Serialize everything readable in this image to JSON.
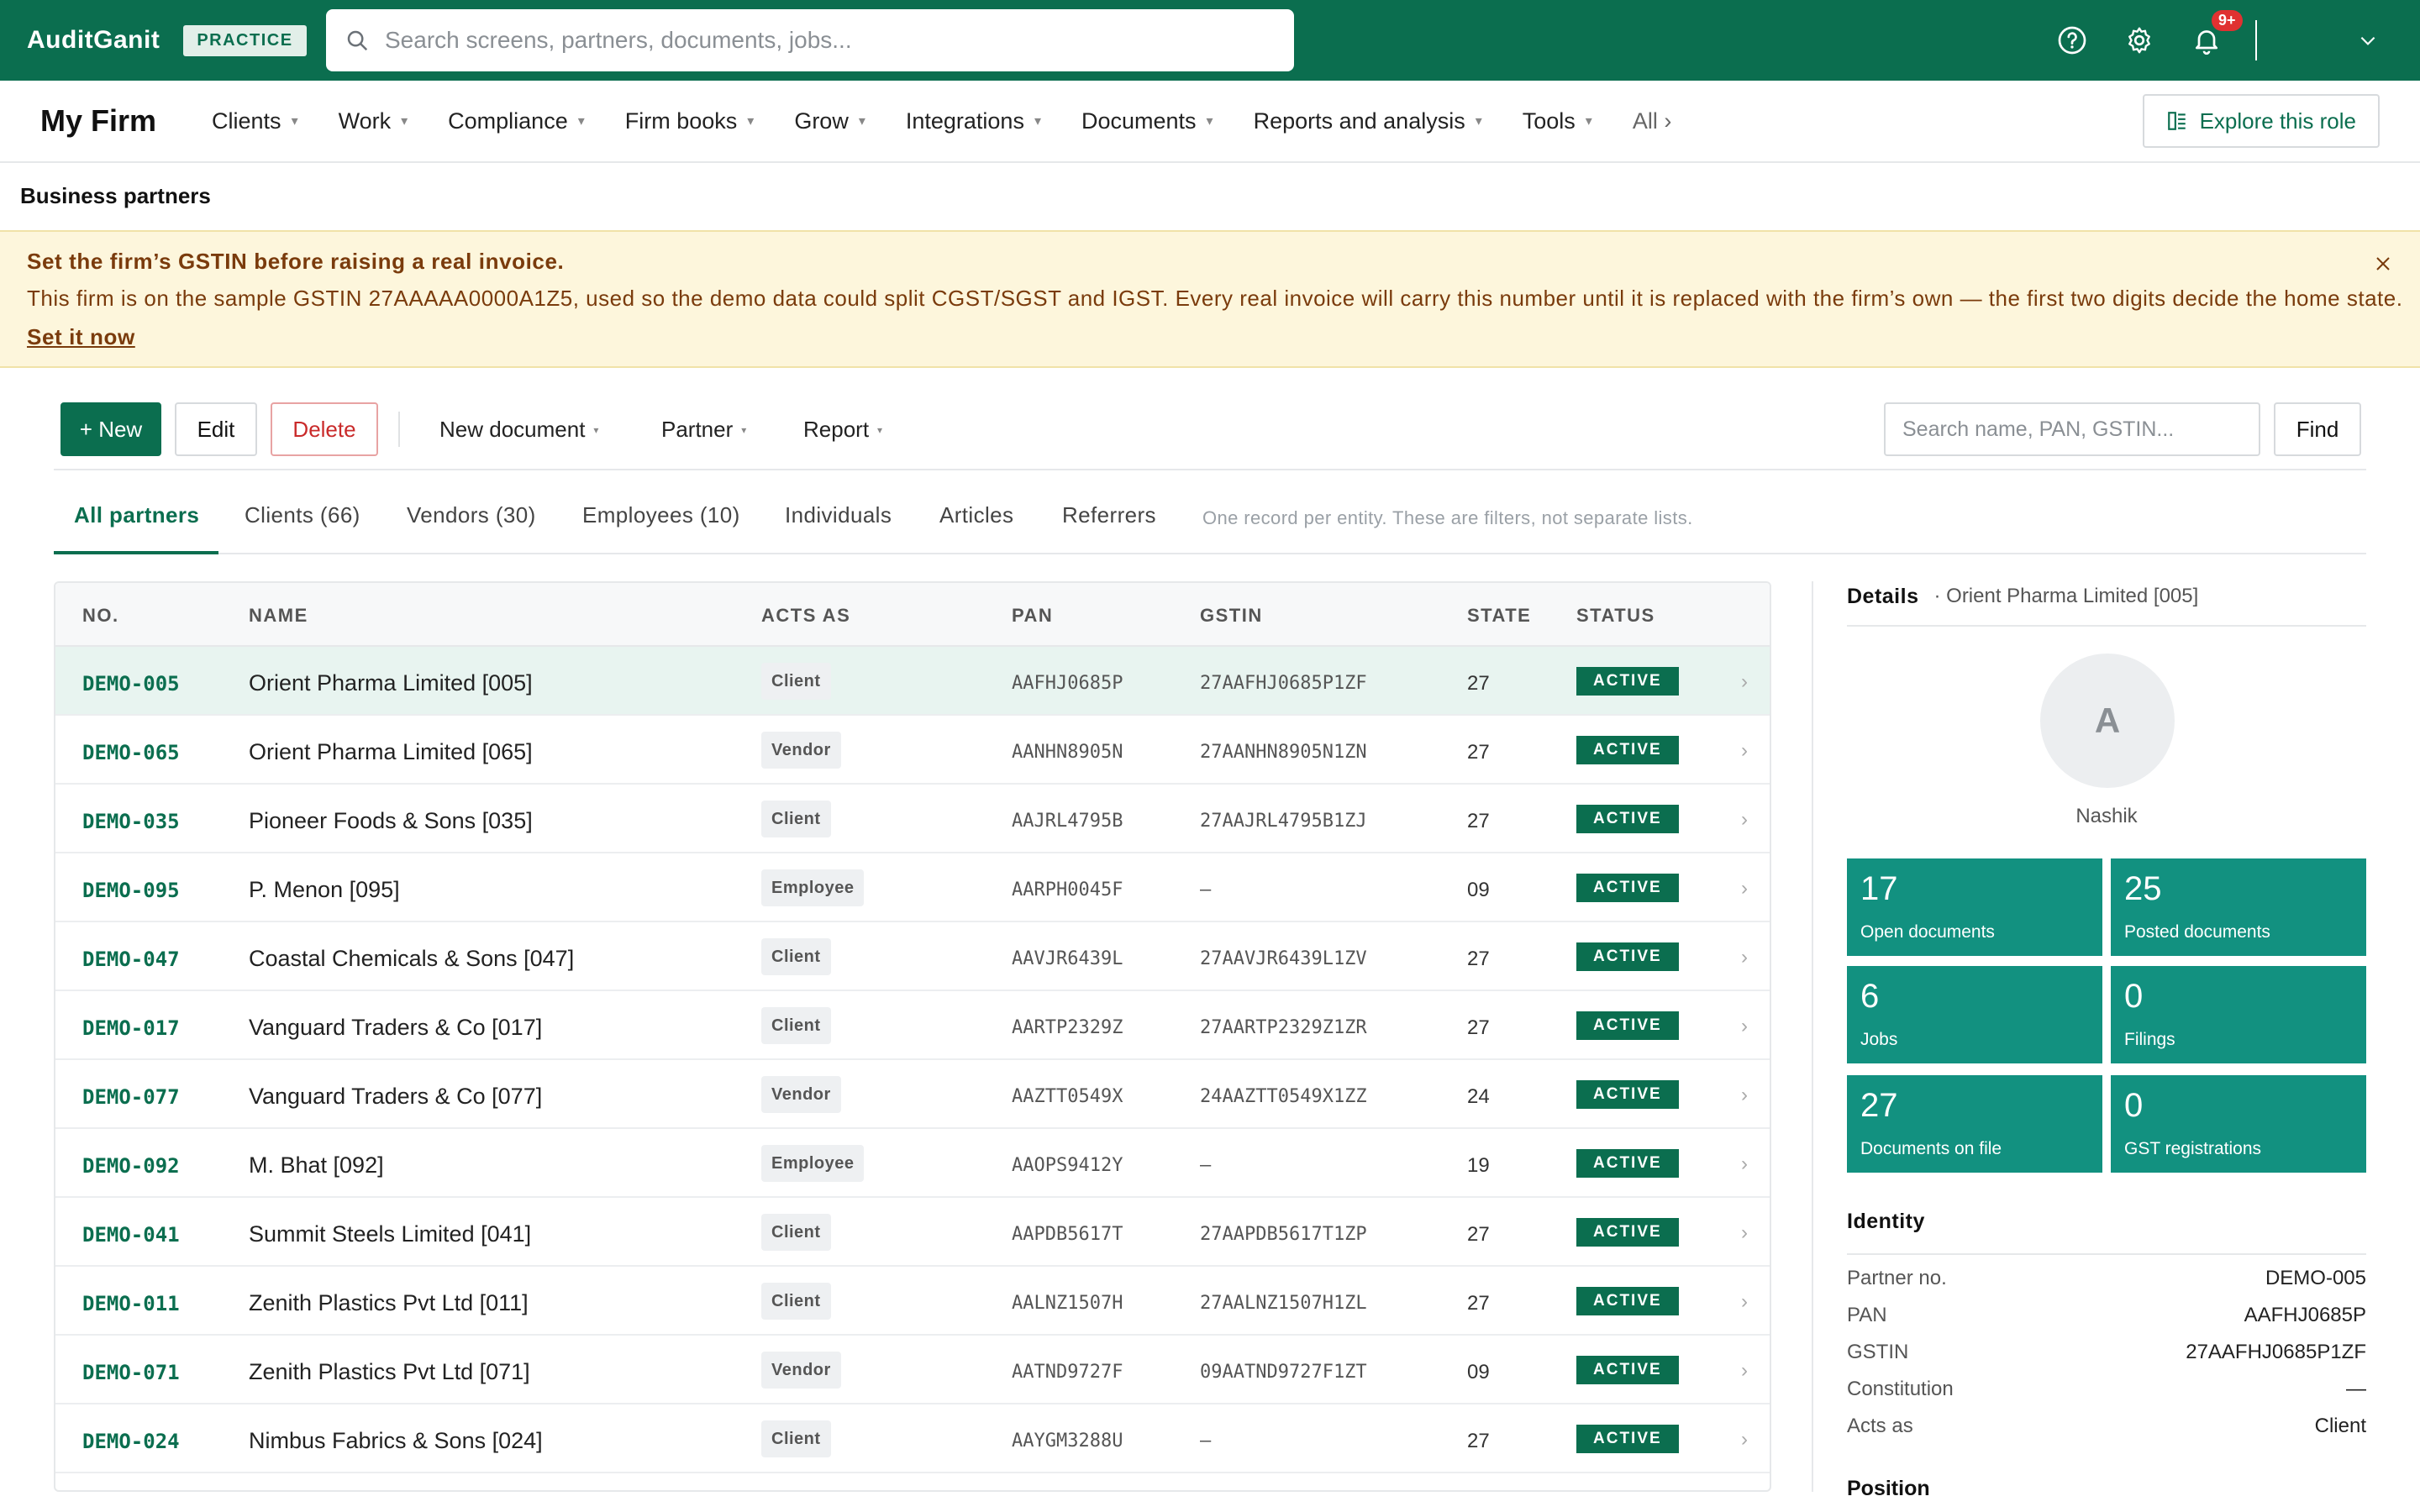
{
  "topbar": {
    "brand": "AuditGanit",
    "badge": "PRACTICE",
    "search_placeholder": "Search screens, partners, documents, jobs...",
    "notification_count": "9+"
  },
  "nav": {
    "firm": "My Firm",
    "items": [
      "Clients",
      "Work",
      "Compliance",
      "Firm books",
      "Grow",
      "Integrations",
      "Documents",
      "Reports and analysis",
      "Tools"
    ],
    "all": "All ›",
    "explore": "Explore this role"
  },
  "page": {
    "title": "Business partners"
  },
  "banner": {
    "title": "Set the firm’s GSTIN before raising a real invoice.",
    "text": "This firm is on the sample GSTIN 27AAAAA0000A1Z5, used so the demo data could split CGST/SGST and IGST. Every real invoice will carry this number until it is replaced with the firm’s own — the first two digits decide the home state.",
    "link": "Set it now"
  },
  "toolbar": {
    "new": "+ New",
    "edit": "Edit",
    "delete": "Delete",
    "new_document": "New document",
    "partner": "Partner",
    "report": "Report",
    "search_placeholder": "Search name, PAN, GSTIN...",
    "find": "Find"
  },
  "tabs": {
    "items": [
      "All partners",
      "Clients (66)",
      "Vendors (30)",
      "Employees (10)",
      "Individuals",
      "Articles",
      "Referrers"
    ],
    "note": "One record per entity. These are filters, not separate lists."
  },
  "table": {
    "headers": [
      "NO.",
      "NAME",
      "ACTS AS",
      "PAN",
      "GSTIN",
      "STATE",
      "STATUS"
    ],
    "rows": [
      {
        "no": "DEMO-005",
        "name": "Orient Pharma Limited [005]",
        "acts": "Client",
        "pan": "AAFHJ0685P",
        "gstin": "27AAFHJ0685P1ZF",
        "state": "27",
        "status": "ACTIVE"
      },
      {
        "no": "DEMO-065",
        "name": "Orient Pharma Limited [065]",
        "acts": "Vendor",
        "pan": "AANHN8905N",
        "gstin": "27AANHN8905N1ZN",
        "state": "27",
        "status": "ACTIVE"
      },
      {
        "no": "DEMO-035",
        "name": "Pioneer Foods & Sons [035]",
        "acts": "Client",
        "pan": "AAJRL4795B",
        "gstin": "27AAJRL4795B1ZJ",
        "state": "27",
        "status": "ACTIVE"
      },
      {
        "no": "DEMO-095",
        "name": "P. Menon [095]",
        "acts": "Employee",
        "pan": "AARPH0045F",
        "gstin": "—",
        "state": "09",
        "status": "ACTIVE"
      },
      {
        "no": "DEMO-047",
        "name": "Coastal Chemicals & Sons [047]",
        "acts": "Client",
        "pan": "AAVJR6439L",
        "gstin": "27AAVJR6439L1ZV",
        "state": "27",
        "status": "ACTIVE"
      },
      {
        "no": "DEMO-017",
        "name": "Vanguard Traders & Co [017]",
        "acts": "Client",
        "pan": "AARTP2329Z",
        "gstin": "27AARTP2329Z1ZR",
        "state": "27",
        "status": "ACTIVE"
      },
      {
        "no": "DEMO-077",
        "name": "Vanguard Traders & Co [077]",
        "acts": "Vendor",
        "pan": "AAZTT0549X",
        "gstin": "24AAZTT0549X1ZZ",
        "state": "24",
        "status": "ACTIVE"
      },
      {
        "no": "DEMO-092",
        "name": "M. Bhat [092]",
        "acts": "Employee",
        "pan": "AAOPS9412Y",
        "gstin": "—",
        "state": "19",
        "status": "ACTIVE"
      },
      {
        "no": "DEMO-041",
        "name": "Summit Steels Limited [041]",
        "acts": "Client",
        "pan": "AAPDB5617T",
        "gstin": "27AAPDB5617T1ZP",
        "state": "27",
        "status": "ACTIVE"
      },
      {
        "no": "DEMO-011",
        "name": "Zenith Plastics Pvt Ltd [011]",
        "acts": "Client",
        "pan": "AALNZ1507H",
        "gstin": "27AALNZ1507H1ZL",
        "state": "27",
        "status": "ACTIVE"
      },
      {
        "no": "DEMO-071",
        "name": "Zenith Plastics Pvt Ltd [071]",
        "acts": "Vendor",
        "pan": "AATND9727F",
        "gstin": "09AATND9727F1ZT",
        "state": "09",
        "status": "ACTIVE"
      },
      {
        "no": "DEMO-024",
        "name": "Nimbus Fabrics & Sons [024]",
        "acts": "Client",
        "pan": "AAYGM3288U",
        "gstin": "—",
        "state": "27",
        "status": "ACTIVE"
      }
    ]
  },
  "details": {
    "title": "Details",
    "subtitle": "· Orient Pharma Limited [005]",
    "avatar": "A",
    "city": "Nashik",
    "stats": [
      {
        "value": "17",
        "label": "Open documents"
      },
      {
        "value": "25",
        "label": "Posted documents"
      },
      {
        "value": "6",
        "label": "Jobs"
      },
      {
        "value": "0",
        "label": "Filings"
      },
      {
        "value": "27",
        "label": "Documents on file"
      },
      {
        "value": "0",
        "label": "GST registrations"
      }
    ],
    "identity_title": "Identity",
    "identity": [
      {
        "k": "Partner no.",
        "v": "DEMO-005"
      },
      {
        "k": "PAN",
        "v": "AAFHJ0685P"
      },
      {
        "k": "GSTIN",
        "v": "27AAFHJ0685P1ZF"
      },
      {
        "k": "Constitution",
        "v": "—"
      },
      {
        "k": "Acts as",
        "v": "Client"
      }
    ],
    "position_title": "Position"
  }
}
